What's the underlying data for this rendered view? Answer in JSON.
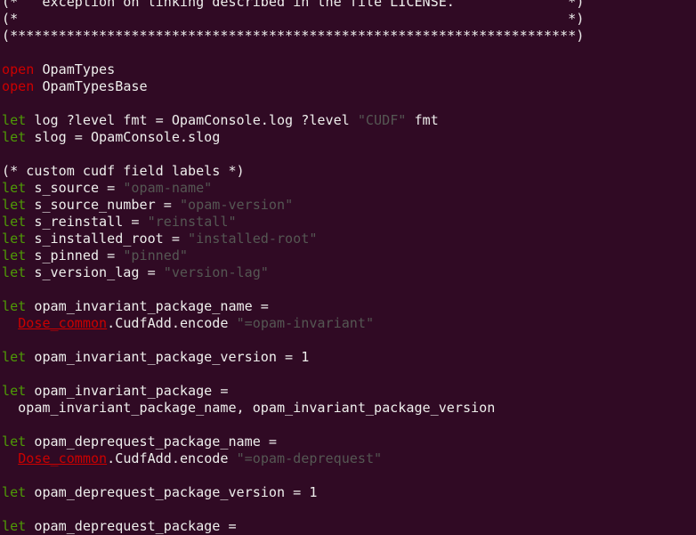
{
  "colors": {
    "background": "#300a24",
    "text": "#eeeeec",
    "keyword": "#4e9a06",
    "open_keyword": "#cc0000",
    "string": "#555753",
    "module": "#cc0000"
  },
  "code_lines": [
    [
      [
        "txt",
        "(*   exception on linking described in the file LICENSE.              *)"
      ]
    ],
    [
      [
        "txt",
        "(*                                                                    *)"
      ]
    ],
    [
      [
        "txt",
        "(**********************************************************************)"
      ]
    ],
    [
      [
        "txt",
        ""
      ]
    ],
    [
      [
        "open",
        "open"
      ],
      [
        "txt",
        " OpamTypes"
      ]
    ],
    [
      [
        "open",
        "open"
      ],
      [
        "txt",
        " OpamTypesBase"
      ]
    ],
    [
      [
        "txt",
        ""
      ]
    ],
    [
      [
        "kw",
        "let"
      ],
      [
        "txt",
        " log ?level fmt = OpamConsole.log ?level "
      ],
      [
        "str",
        "\"CUDF\""
      ],
      [
        "txt",
        " fmt"
      ]
    ],
    [
      [
        "kw",
        "let"
      ],
      [
        "txt",
        " slog = OpamConsole.slog"
      ]
    ],
    [
      [
        "txt",
        ""
      ]
    ],
    [
      [
        "txt",
        "(* custom cudf field labels *)"
      ]
    ],
    [
      [
        "kw",
        "let"
      ],
      [
        "txt",
        " s_source = "
      ],
      [
        "str",
        "\"opam-name\""
      ]
    ],
    [
      [
        "kw",
        "let"
      ],
      [
        "txt",
        " s_source_number = "
      ],
      [
        "str",
        "\"opam-version\""
      ]
    ],
    [
      [
        "kw",
        "let"
      ],
      [
        "txt",
        " s_reinstall = "
      ],
      [
        "str",
        "\"reinstall\""
      ]
    ],
    [
      [
        "kw",
        "let"
      ],
      [
        "txt",
        " s_installed_root = "
      ],
      [
        "str",
        "\"installed-root\""
      ]
    ],
    [
      [
        "kw",
        "let"
      ],
      [
        "txt",
        " s_pinned = "
      ],
      [
        "str",
        "\"pinned\""
      ]
    ],
    [
      [
        "kw",
        "let"
      ],
      [
        "txt",
        " s_version_lag = "
      ],
      [
        "str",
        "\"version-lag\""
      ]
    ],
    [
      [
        "txt",
        ""
      ]
    ],
    [
      [
        "kw",
        "let"
      ],
      [
        "txt",
        " opam_invariant_package_name ="
      ]
    ],
    [
      [
        "txt",
        "  "
      ],
      [
        "mod",
        "Dose_common"
      ],
      [
        "txt",
        ".CudfAdd.encode "
      ],
      [
        "str",
        "\"=opam-invariant\""
      ]
    ],
    [
      [
        "txt",
        ""
      ]
    ],
    [
      [
        "kw",
        "let"
      ],
      [
        "txt",
        " opam_invariant_package_version = 1"
      ]
    ],
    [
      [
        "txt",
        ""
      ]
    ],
    [
      [
        "kw",
        "let"
      ],
      [
        "txt",
        " opam_invariant_package ="
      ]
    ],
    [
      [
        "txt",
        "  opam_invariant_package_name, opam_invariant_package_version"
      ]
    ],
    [
      [
        "txt",
        ""
      ]
    ],
    [
      [
        "kw",
        "let"
      ],
      [
        "txt",
        " opam_deprequest_package_name ="
      ]
    ],
    [
      [
        "txt",
        "  "
      ],
      [
        "mod",
        "Dose_common"
      ],
      [
        "txt",
        ".CudfAdd.encode "
      ],
      [
        "str",
        "\"=opam-deprequest\""
      ]
    ],
    [
      [
        "txt",
        ""
      ]
    ],
    [
      [
        "kw",
        "let"
      ],
      [
        "txt",
        " opam_deprequest_package_version = 1"
      ]
    ],
    [
      [
        "txt",
        ""
      ]
    ],
    [
      [
        "kw",
        "let"
      ],
      [
        "txt",
        " opam_deprequest_package ="
      ]
    ]
  ]
}
